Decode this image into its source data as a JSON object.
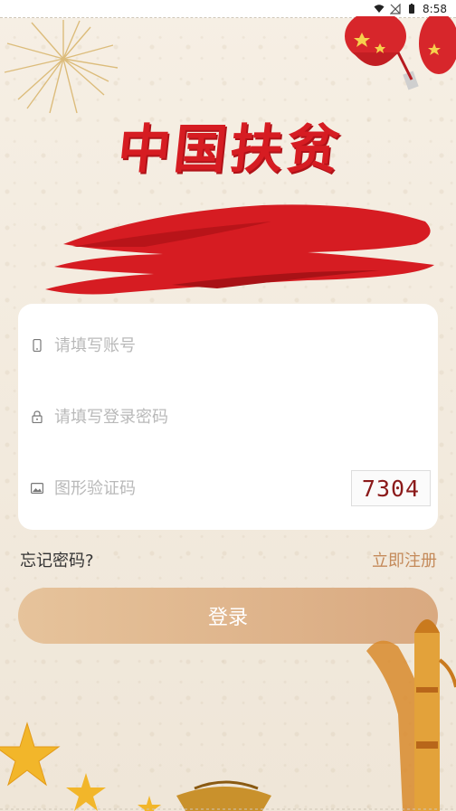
{
  "status_bar": {
    "time": "8:58",
    "icons": [
      "wifi-icon",
      "signal-off-icon",
      "battery-icon"
    ]
  },
  "header": {
    "title": "中国扶贫"
  },
  "form": {
    "account_placeholder": "请填写账号",
    "password_placeholder": "请填写登录密码",
    "captcha_placeholder": "图形验证码",
    "captcha_code": "7304"
  },
  "links": {
    "forgot_password": "忘记密码?",
    "register": "立即注册"
  },
  "actions": {
    "login_label": "登录"
  },
  "colors": {
    "accent": "#d61c22",
    "button_start": "#e6c39b",
    "button_end": "#d9a980",
    "link": "#c48a5a"
  }
}
